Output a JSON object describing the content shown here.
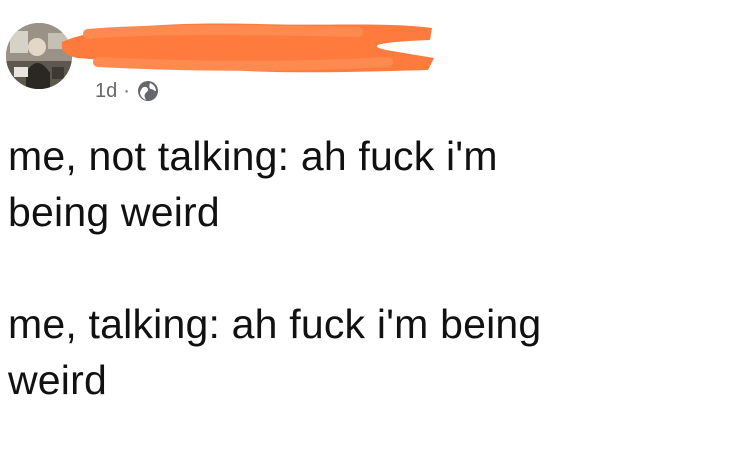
{
  "post": {
    "author_avatar_icon": "profile-photo-icon",
    "author_name_redacted": true,
    "redaction_color": "#ff7a3d",
    "timestamp": "1d",
    "separator": "·",
    "privacy_icon": "globe-icon",
    "paragraphs": [
      "me, not talking: ah fuck i'm\nbeing weird",
      "me, talking: ah fuck i'm being\nweird"
    ]
  }
}
